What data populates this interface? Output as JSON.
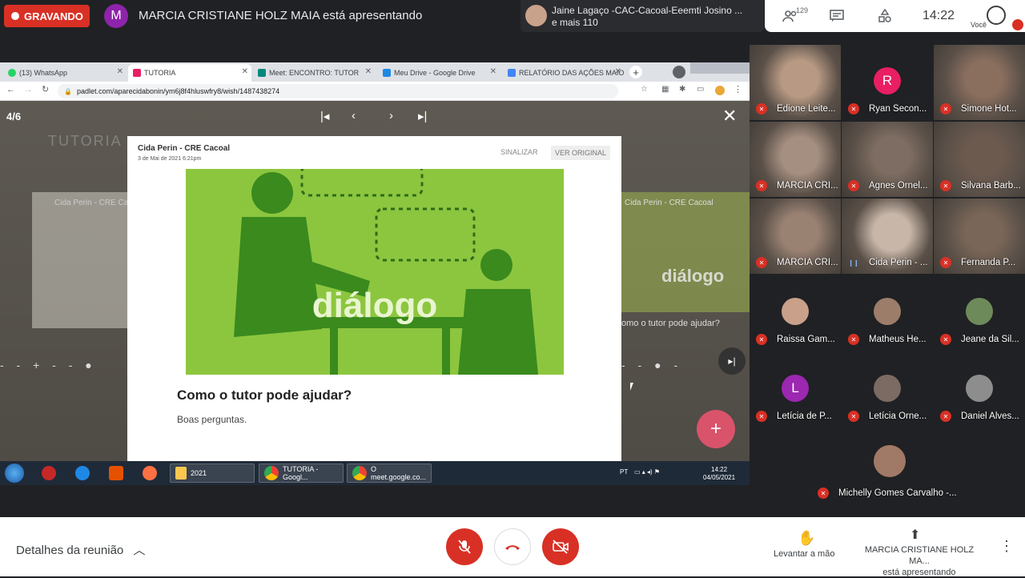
{
  "recording": {
    "label": "GRAVANDO"
  },
  "presenter": {
    "initial": "M",
    "text": "MARCIA CRISTIANE HOLZ MAIA está apresentando"
  },
  "joined": {
    "name": "Jaine Lagaço -CAC-Cacoal-Eeemti Josino ...",
    "more": "e mais 110"
  },
  "top_controls": {
    "people_count": "129",
    "clock": "14:22",
    "you_label": "Você"
  },
  "browser": {
    "tabs": [
      {
        "label": "(13) WhatsApp",
        "color": "#25d366"
      },
      {
        "label": "TUTORIA",
        "color": "#e91e63"
      },
      {
        "label": "Meet: ENCONTRO: TUTOR",
        "color": "#00897b"
      },
      {
        "label": "Meu Drive - Google Drive",
        "color": "#1e88e5"
      },
      {
        "label": "RELATÓRIO DAS AÇÕES MAIO",
        "color": "#4285f4"
      }
    ],
    "url": "padlet.com/aparecidabonin/ym6j8f4hluswfry8/wish/1487438274"
  },
  "padlet": {
    "position": "4/6",
    "side_left_title": "TUTORIA",
    "side_left_name": "Cida Perin - CRE Ca",
    "side_right_name": "Cida Perin - CRE Cacoal",
    "side_right_word": "diálogo",
    "side_right_question": "omo o tutor pode ajudar?",
    "post": {
      "author": "Cida Perin - CRE Cacoal",
      "date": "3 de Mai de 2021 6:21pm",
      "report": "SINALIZAR",
      "original": "VER ORIGINAL",
      "image_word": "diálogo",
      "title": "Como o tutor pode ajudar?",
      "body": "Boas perguntas."
    }
  },
  "taskbar": {
    "items": [
      {
        "label": "2021"
      },
      {
        "label": "TUTORIA - Googl..."
      },
      {
        "label": "O meet.google.co..."
      }
    ],
    "lang": "PT",
    "time": "14:22",
    "date": "04/05/2021"
  },
  "participants": [
    {
      "name": "Edione Leite...",
      "type": "video",
      "color": "#b89a84"
    },
    {
      "name": "Ryan Secon...",
      "type": "avatar",
      "initial": "R",
      "color": "#e91e63"
    },
    {
      "name": "Simone Hot...",
      "type": "video",
      "color": "#8a6e5e"
    },
    {
      "name": "MARCIA CRI...",
      "type": "video",
      "color": "#a58f80"
    },
    {
      "name": "Agnes Ornel...",
      "type": "video",
      "color": "#7e6d62"
    },
    {
      "name": "Silvana Barb...",
      "type": "video",
      "color": "#6d5a4f"
    },
    {
      "name": "MARCIA CRI...",
      "type": "video",
      "color": "#9a8273"
    },
    {
      "name": "Cida Perin - ...",
      "type": "video",
      "color": "#c8b6a8",
      "speaking": true
    },
    {
      "name": "Fernanda P...",
      "type": "video",
      "color": "#7a6658"
    },
    {
      "name": "Raissa Gam...",
      "type": "photo",
      "color": "#c9a08a"
    },
    {
      "name": "Matheus He...",
      "type": "photo",
      "color": "#9c7d6a"
    },
    {
      "name": "Jeane da Sil...",
      "type": "photo",
      "color": "#6d8a5a"
    },
    {
      "name": "Letícia de P...",
      "type": "avatar",
      "initial": "L",
      "color": "#9c27b0"
    },
    {
      "name": "Letícia Orne...",
      "type": "photo",
      "color": "#7c6b63"
    },
    {
      "name": "Daniel Alves...",
      "type": "photo",
      "color": "#8d8d8d"
    },
    {
      "name": "Michelly Gomes Carvalho -...",
      "type": "photo",
      "color": "#a07a66"
    }
  ],
  "bottom": {
    "details": "Detalhes da reunião",
    "raise_hand": "Levantar a mão",
    "presenting_name": "MARCIA CRISTIANE HOLZ MA...",
    "presenting_status": "está apresentando"
  }
}
